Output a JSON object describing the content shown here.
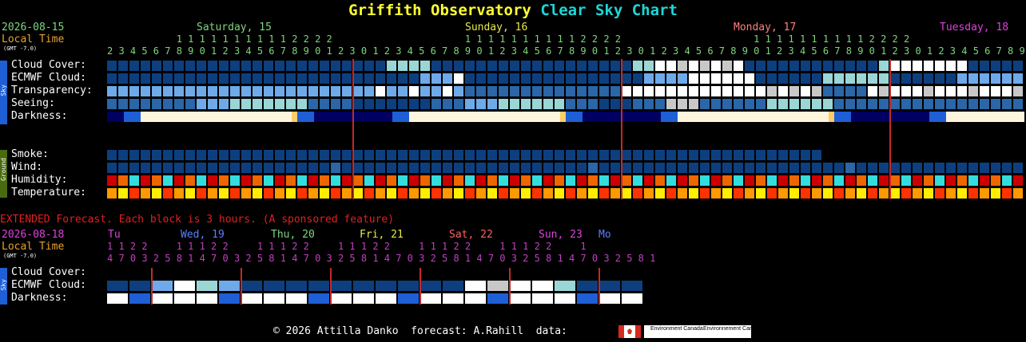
{
  "title": {
    "observatory": "Griffith Observatory",
    "chart": "Clear Sky Chart"
  },
  "header": {
    "date": "2026-08-15",
    "local_time": "Local Time",
    "gmt": "(GMT -7.0)",
    "days": [
      {
        "label": "Saturday, 15",
        "color": "#7fd67f"
      },
      {
        "label": "Sunday, 16",
        "color": "#e8e84a"
      },
      {
        "label": "Monday, 17",
        "color": "#ff7f7f"
      },
      {
        "label": "Tuesday, 18",
        "color": "#e040e0"
      }
    ],
    "tens_row": "            1 1 1 1 1 1 1 1 1 1 2 2 2 2                       1 1 1 1 1 1 1 1 1 1 2 2 2 2                       1 1 1 1 1 1 1 1 1 1 2 2 2 2                       1 1",
    "ones_row": "2 3 4 5 6 7 8 9 0 1 2 3 4 5 6 7 8 9 0 1 2 3 0 1 2 3 4 5 6 7 8 9 0 1 2 3 4 5 6 7 8 9 0 1 2 3 0 1 2 3 4 5 6 7 8 9 0 1 2 3 4 5 6 7 8 9 0 1 2 3 0 1 2 3 4 5 6 7 8 9 0 1"
  },
  "rows": {
    "cloud_cover": "Cloud Cover:",
    "ecmwf_cloud": "ECMWF Cloud:",
    "transparency": "Transparency:",
    "seeing": "Seeing:",
    "darkness": "Darkness:",
    "smoke": "Smoke:",
    "wind": "Wind:",
    "humidity": "Humidity:",
    "temperature": "Temperature:"
  },
  "sidebar": {
    "sky": "Sky",
    "ground": "Ground"
  },
  "extended": {
    "notice": "EXTENDED Forecast. Each block is 3 hours. (A sponsored feature)",
    "date": "2026-08-18",
    "local_time": "Local Time",
    "gmt": "(GMT -7.0)",
    "days": [
      {
        "label": "Tu",
        "color": "#e040e0"
      },
      {
        "label": "Wed, 19",
        "color": "#5a7fff"
      },
      {
        "label": "Thu, 20",
        "color": "#7fd67f"
      },
      {
        "label": "Fri, 21",
        "color": "#e8e84a"
      },
      {
        "label": "Sat, 22",
        "color": "#ff6060"
      },
      {
        "label": "Sun, 23",
        "color": "#e040e0"
      },
      {
        "label": "Mo",
        "color": "#5a7fff"
      }
    ],
    "tens_row": "1 1 2 2     1 1 1 2 2     1 1 1 2 2     1 1 1 2 2     1 1 1 2 2     1 1 1 2 2     1",
    "ones_row": "4 7 0 3 2 5 8 1 4 7 0 3 2 5 8 1 4 7 0 3 2 5 8 1 4 7 0 3 2 5 8 1 4 7 0 3 2 5 8 1 4 7 0 3 2 5 8 1",
    "rows": {
      "cloud_cover": "Cloud Cover:",
      "ecmwf_cloud": "ECMWF Cloud:",
      "darkness": "Darkness:"
    }
  },
  "footer": {
    "text": "© 2026 Attilla Danko  forecast: A.Rahill  data:",
    "logo_1": "Environment Canada",
    "logo_2": "Environnement Canada"
  },
  "colors": {
    "dark_blue": "#0d3f7f",
    "mid_blue": "#2a66a8",
    "light_blue": "#6eaaea",
    "cyan_ish": "#9ad6d6",
    "white": "#ffffff",
    "grey": "#c8c8c8",
    "red_line": "#c62828"
  }
}
